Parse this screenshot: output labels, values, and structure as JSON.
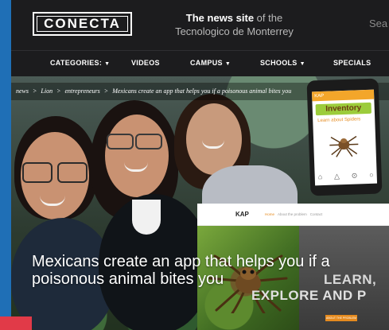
{
  "header": {
    "logo_text": "CONECTA",
    "tagline_bold": "The news site",
    "tagline_rest_line1": " of the",
    "tagline_line2": "Tecnologico de Monterrey",
    "search_placeholder": "Sea"
  },
  "nav": {
    "items": [
      {
        "label": "CATEGORIES:",
        "has_caret": true
      },
      {
        "label": "VIDEOS",
        "has_caret": false
      },
      {
        "label": "CAMPUS",
        "has_caret": true
      },
      {
        "label": "SCHOOLS",
        "has_caret": true
      },
      {
        "label": "SPECIALS",
        "has_caret": false
      }
    ],
    "caret_glyph": "▼"
  },
  "breadcrumb": {
    "items": [
      "news",
      "Lion",
      "entrepreneurs",
      "Mexicans create an app that helps you if a poisonous animal bites you"
    ],
    "separator": ">"
  },
  "phone": {
    "app_bar": "KAP",
    "app_title": "Inventory",
    "app_sub": "Learn about Spiders",
    "icons": [
      "home-icon",
      "triangle-icon",
      "pin-icon",
      "search-icon"
    ]
  },
  "webcard": {
    "brand": "KAP",
    "links": [
      "Home",
      "About the problem",
      "Contact"
    ],
    "active_link": "Home",
    "learn_text": "LEARN,",
    "explore_text": "EXPLORE AND P",
    "button_text": "ABOUT THE PROBLEM"
  },
  "article": {
    "headline": "Mexicans create an app that helps you if a poisonous animal bites you"
  },
  "colors": {
    "header_bg": "#1c1c1e",
    "accent_blue": "#1f6fb6",
    "accent_red": "#e13a48",
    "kap_orange": "#e58a1e"
  }
}
